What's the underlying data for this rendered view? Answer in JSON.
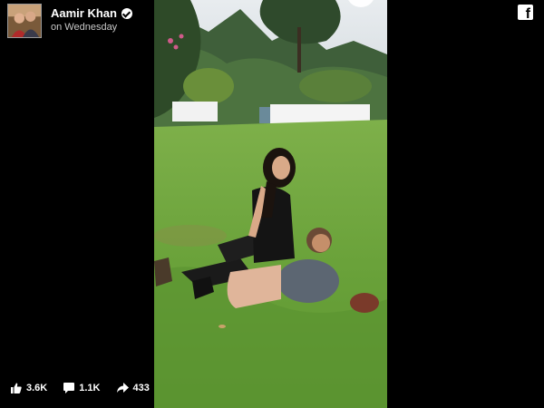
{
  "post": {
    "author": "Aamir Khan",
    "timestamp": "on Wednesday",
    "verified": true
  },
  "icons": {
    "brand": "facebook-icon",
    "like": "thumbs-up-icon",
    "comment": "comment-icon",
    "share": "share-arrow-icon"
  },
  "stats": {
    "likes": "3.6K",
    "comments": "1.1K",
    "shares": "433"
  },
  "colors": {
    "background": "#000000",
    "text": "#ffffff"
  }
}
